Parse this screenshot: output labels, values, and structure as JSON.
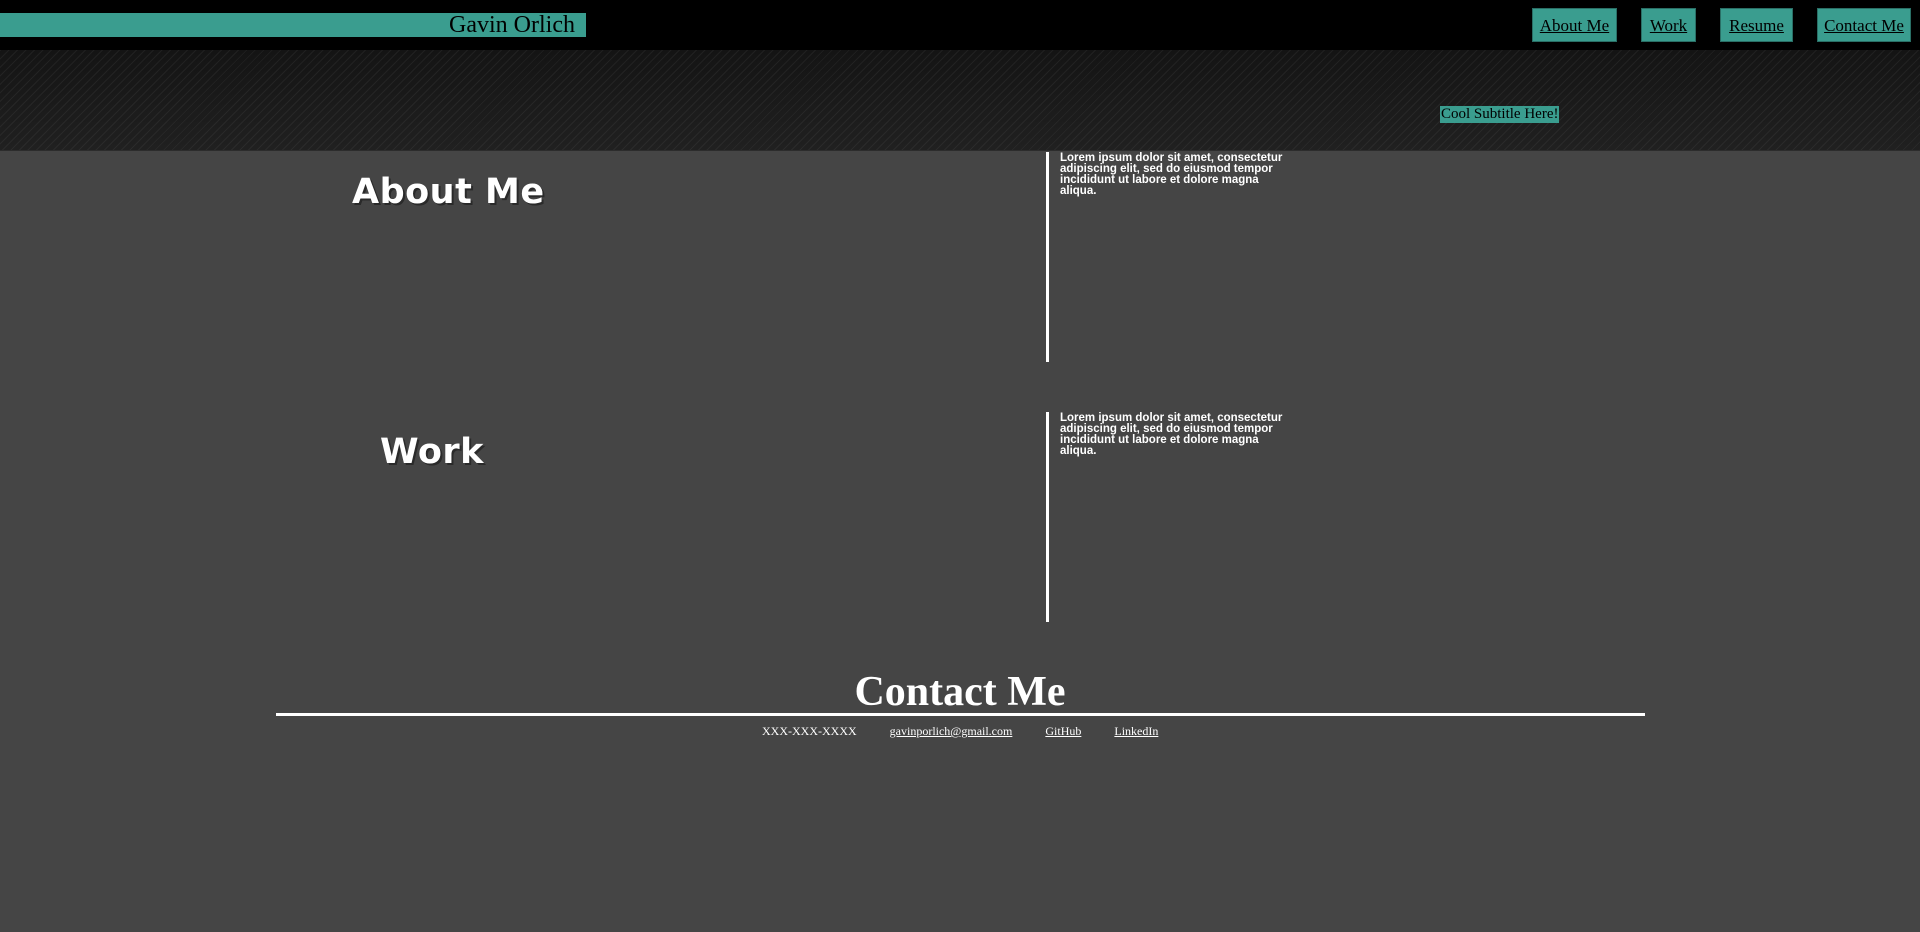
{
  "header": {
    "brand": "Gavin Orlich",
    "nav": [
      {
        "label": "About Me"
      },
      {
        "label": "Work"
      },
      {
        "label": "Resume"
      },
      {
        "label": "Contact Me"
      }
    ]
  },
  "hero": {
    "subtitle": "Cool Subtitle Here!"
  },
  "sections": [
    {
      "title": "About Me",
      "text": "Lorem ipsum dolor sit amet, consectetur adipiscing elit, sed do eiusmod tempor incididunt ut labore et dolore magna aliqua."
    },
    {
      "title": "Work",
      "text": "Lorem ipsum dolor sit amet, consectetur adipiscing elit, sed do eiusmod tempor incididunt ut labore et dolore magna aliqua."
    }
  ],
  "contact": {
    "title": "Contact Me",
    "phone": "XXX-XXX-XXXX",
    "email": "gavinporlich@gmail.com",
    "github": "GitHub",
    "linkedin": "LinkedIn"
  },
  "colors": {
    "accent": "#3a9d8f",
    "page_background": "#454545",
    "topbar": "#000000"
  }
}
